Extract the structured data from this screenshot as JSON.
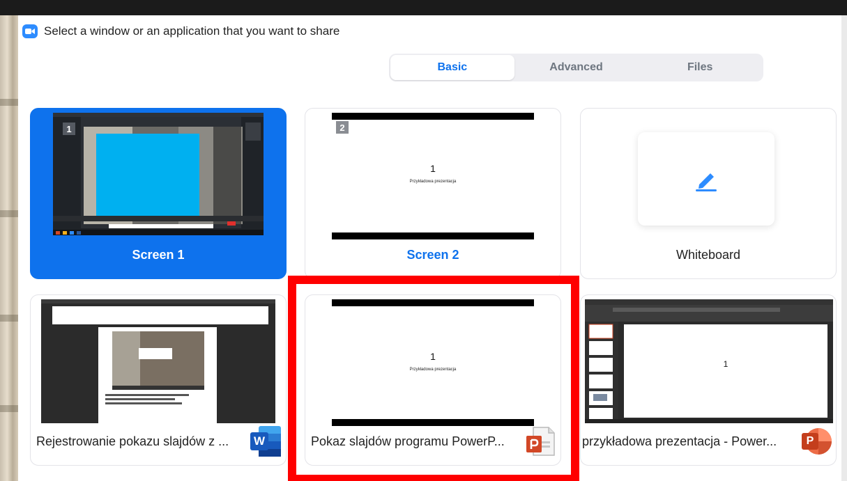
{
  "dialog": {
    "title": "Select a window or an application that you want to share"
  },
  "tabs": [
    {
      "label": "Basic",
      "active": true
    },
    {
      "label": "Advanced",
      "active": false
    },
    {
      "label": "Files",
      "active": false
    }
  ],
  "sources": [
    {
      "label": "Screen 1",
      "badge": "1",
      "selected": true
    },
    {
      "label": "Screen 2",
      "badge": "2",
      "slide_number": "1",
      "slide_subtitle": "Przykładowa prezentacja"
    },
    {
      "label": "Whiteboard"
    },
    {
      "label": "Rejestrowanie pokazu slajdów z ...",
      "app": "Word",
      "app_letter": "W"
    },
    {
      "label": "Pokaz slajdów programu PowerP...",
      "app": "PowerPoint",
      "slide_number": "1",
      "slide_subtitle": "Przykładowa prezentacja"
    },
    {
      "label": "przykładowa prezentacja - Power...",
      "app": "PowerPoint",
      "app_letter": "P",
      "slide_number": "1"
    }
  ],
  "colors": {
    "accent": "#0e72ed",
    "highlight": "#ff0000",
    "word": "#2b5797",
    "powerpoint": "#d24726"
  }
}
